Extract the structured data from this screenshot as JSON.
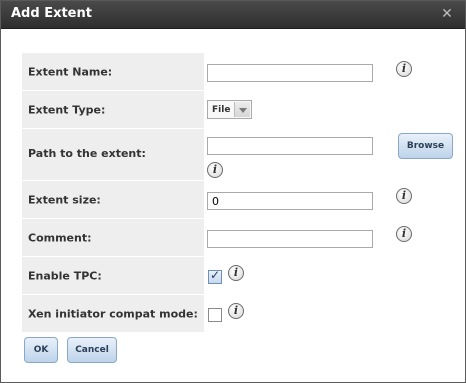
{
  "dialog": {
    "title": "Add Extent",
    "close_icon": "close-x-icon"
  },
  "form": {
    "extent_name": {
      "label": "Extent Name:",
      "value": ""
    },
    "extent_type": {
      "label": "Extent Type:",
      "selected": "File"
    },
    "path": {
      "label": "Path to the extent:",
      "value": "",
      "browse_label": "Browse"
    },
    "extent_size": {
      "label": "Extent size:",
      "value": "0"
    },
    "comment": {
      "label": "Comment:",
      "value": ""
    },
    "enable_tpc": {
      "label": "Enable TPC:",
      "checked": true
    },
    "xen_compat": {
      "label": "Xen initiator compat mode:",
      "checked": false
    }
  },
  "buttons": {
    "ok_label": "OK",
    "cancel_label": "Cancel"
  },
  "info_glyph": "i",
  "colors": {
    "titlebar": "#3a3a3a",
    "label_bg": "#eeeeee",
    "button_bg": "#cfe0f1"
  }
}
